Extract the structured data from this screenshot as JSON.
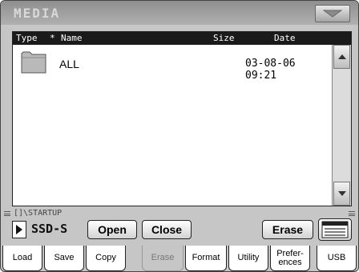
{
  "window": {
    "title": "MEDIA"
  },
  "browser": {
    "columns": {
      "type": "Type",
      "sort_marker": "*",
      "name": "Name",
      "size": "Size",
      "date": "Date"
    },
    "rows": [
      {
        "icon": "folder-icon",
        "name": "ALL",
        "size": "",
        "date": "03-08-06 09:21"
      }
    ]
  },
  "path": {
    "text": "[]\\STARTUP"
  },
  "device": {
    "name": "SSD-S"
  },
  "actions": {
    "open": "Open",
    "close": "Close",
    "erase": "Erase"
  },
  "tabs": [
    {
      "label": "Load",
      "active": false
    },
    {
      "label": "Save",
      "active": false
    },
    {
      "label": "Copy",
      "active": false
    },
    {
      "label": "Erase",
      "active": true
    },
    {
      "label": "Format",
      "active": false
    },
    {
      "label": "Utility",
      "active": false
    },
    {
      "label": "Prefer-\nences",
      "active": false
    },
    {
      "label": "USB",
      "active": false
    }
  ]
}
